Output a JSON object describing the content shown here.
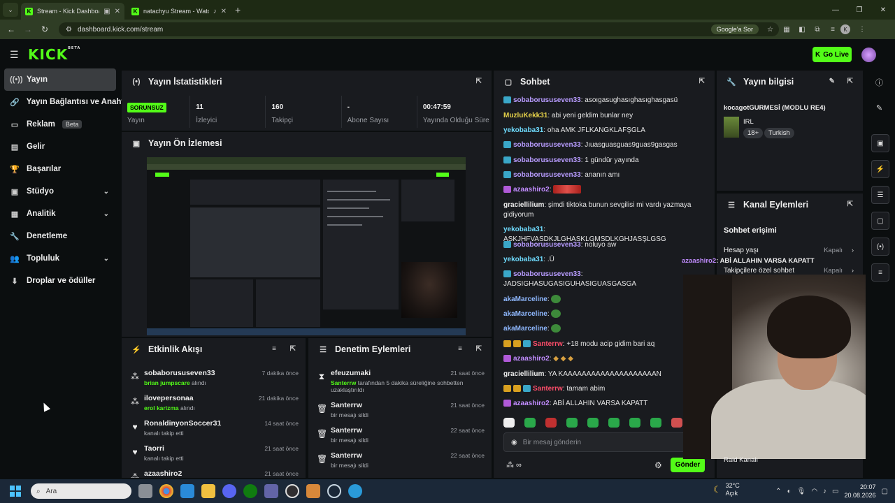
{
  "browser": {
    "tabs": [
      {
        "title": "Stream - Kick Dashboard",
        "active": true
      },
      {
        "title": "natachyu Stream - Watch Li",
        "active": false
      }
    ],
    "url": "dashboard.kick.com/stream",
    "google_btn": "Google'a Sor",
    "profile_initial": "K"
  },
  "header": {
    "go_live": "Go Live"
  },
  "sidebar": {
    "items": [
      {
        "label": "Yayın",
        "icon": "broadcast-icon",
        "active": true
      },
      {
        "label": "Yayın Bağlantısı ve Anahtarı",
        "icon": "link-icon"
      },
      {
        "label": "Reklam",
        "icon": "ad-icon",
        "badge": "Beta"
      },
      {
        "label": "Gelir",
        "icon": "revenue-icon"
      },
      {
        "label": "Başarılar",
        "icon": "trophy-icon"
      },
      {
        "label": "Stüdyo",
        "icon": "studio-icon",
        "chevron": true
      },
      {
        "label": "Analitik",
        "icon": "analytics-icon",
        "chevron": true
      },
      {
        "label": "Denetleme",
        "icon": "wrench-icon"
      },
      {
        "label": "Topluluk",
        "icon": "community-icon",
        "chevron": true
      },
      {
        "label": "Droplar ve ödüller",
        "icon": "drops-icon"
      }
    ]
  },
  "stats": {
    "title": "Yayın İstatistikleri",
    "status_badge": "SORUNSUZ",
    "status_label": "Yayın",
    "items": [
      {
        "value": "11",
        "label": "İzleyici"
      },
      {
        "value": "160",
        "label": "Takipçi"
      },
      {
        "value": "-",
        "label": "Abone Sayısı"
      },
      {
        "value": "00:47:59",
        "label": "Yayında Olduğu Süre"
      }
    ]
  },
  "preview": {
    "title": "Yayın Ön İzlemesi"
  },
  "activity": {
    "title": "Etkinlik Akışı",
    "items": [
      {
        "name": "sobaborususeven33",
        "highlight": "brian jumpscare",
        "rest": " alındı",
        "time": "7 dakika önce"
      },
      {
        "name": "ilovepersonaa",
        "highlight": "erol karizma",
        "rest": " alındı",
        "time": "21 dakika önce"
      },
      {
        "name": "RonaldinyonSoccer31",
        "highlight": "",
        "rest": "kanalı takip etti",
        "time": "14 saat önce"
      },
      {
        "name": "Taorri",
        "highlight": "",
        "rest": "kanalı takip etti",
        "time": "21 saat önce"
      },
      {
        "name": "azaashiro2",
        "highlight": "",
        "rest": "",
        "time": "21 saat önce"
      }
    ]
  },
  "moderation": {
    "title": "Denetim Eylemleri",
    "items": [
      {
        "name": "efeuzumaki",
        "highlight": "Santerrw",
        "rest": " tarafından 5 dakika süreliğine sohbetten",
        "rest2": "uzaklaştırıldı",
        "time": "21 saat önce"
      },
      {
        "name": "Santerrw",
        "highlight": "",
        "rest": "bir mesajı sildi",
        "rest2": "",
        "time": "21 saat önce"
      },
      {
        "name": "Santerrw",
        "highlight": "",
        "rest": "bir mesajı sildi",
        "rest2": "",
        "time": "22 saat önce"
      },
      {
        "name": "Santerrw",
        "highlight": "",
        "rest": "bir mesajı sildi",
        "rest2": "",
        "time": "22 saat önce"
      }
    ]
  },
  "chat": {
    "title": "Sohbet",
    "messages": [
      {
        "user": "sobaborususeven33",
        "color": "#b89cff",
        "text": ": asoıgasughasıghasıghasgasü"
      },
      {
        "user": "MuzluKekk31",
        "color": "#e6d24a",
        "text": ": abi yeni geldim bunlar ney"
      },
      {
        "user": "yekobaba31",
        "color": "#6fdcff",
        "text": ": oha AMK JFLKANGKLAFŞGLA"
      },
      {
        "user": "sobaborususeven33",
        "color": "#b89cff",
        "text": ": Jıuasguasguas9guas9gasgas"
      },
      {
        "user": "sobaborususeven33",
        "color": "#b89cff",
        "text": ": 1 gündür yayında"
      },
      {
        "user": "sobaborususeven33",
        "color": "#b89cff",
        "text": ": ananın amı"
      },
      {
        "user": "azaashiro2",
        "color": "#c18cff",
        "text": ":"
      },
      {
        "user": "graciellilium",
        "color": "#eeeeee",
        "text": ": şimdi tiktoka bunun sevgilisi mi vardı yazmaya gidiyorum"
      },
      {
        "user": "yekobaba31",
        "color": "#6fdcff",
        "text": ": ASKJHFVASDKJLGHASKLGMSDLKGHJASŞLGSG"
      },
      {
        "user": "sobaborususeven33",
        "color": "#b89cff",
        "text": ": noluyo aw"
      },
      {
        "user": "yekobaba31",
        "color": "#6fdcff",
        "text": ": .Ü"
      },
      {
        "user": "sobaborususeven33",
        "color": "#b89cff",
        "text": ": JADSIGHASUGASIGUHASIGUASGASGA"
      },
      {
        "user": "akaMarceline",
        "color": "#8fb8ff",
        "text": ":"
      },
      {
        "user": "akaMarceline",
        "color": "#8fb8ff",
        "text": ":"
      },
      {
        "user": "akaMarceline",
        "color": "#8fb8ff",
        "text": ":"
      },
      {
        "user": "Santerrw",
        "color": "#ff4d6a",
        "text": ": +18 modu acip gidim bari aq"
      },
      {
        "user": "azaashiro2",
        "color": "#c18cff",
        "text": ":"
      },
      {
        "user": "graciellilium",
        "color": "#eeeeee",
        "text": ": YA KAAAAAAAAAAAAAAAAAAAAN"
      },
      {
        "user": "Santerrw",
        "color": "#ff4d6a",
        "text": ": tamam abim"
      },
      {
        "user": "azaashiro2",
        "color": "#c18cff",
        "text": ": ABİ ALLAHIN VARSA KAPATT"
      }
    ],
    "input_placeholder": "Bir mesaj gönderin",
    "send": "Gönder"
  },
  "info": {
    "title": "Yayın bilgisi",
    "stream_title": "kocagotGURMESİ (MODLU RE4)",
    "category": "IRL",
    "tags": [
      "18+",
      "Turkish"
    ]
  },
  "channel_actions": {
    "title": "Kanal Eylemleri",
    "subtitle": "Sohbet erişimi",
    "rows": [
      {
        "label": "Hesap yaşı",
        "state": "Kapalı"
      },
      {
        "label": "Takipçilere özel sohbet",
        "state": "Kapalı"
      }
    ],
    "raid": "Raid Kanalı"
  },
  "overlay_chat": {
    "user": "azaashiro2",
    "text": ": ABİ ALLAHIN VARSA KAPATT"
  },
  "taskbar": {
    "search": "Ara",
    "temp": "32°C",
    "weather": "Açık",
    "time": "20:07",
    "date": "20.08.2026"
  }
}
